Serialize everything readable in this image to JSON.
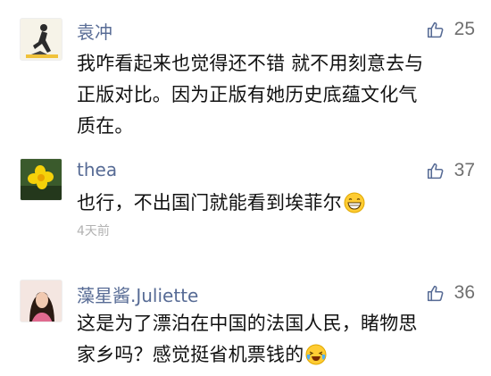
{
  "comments": [
    {
      "name": "袁冲",
      "likes": "25",
      "lines": [
        "我咋看起来也觉得还不错 就不用刻意去与",
        "正版对比。因为正版有她历史底蕴文化气",
        "质在。"
      ],
      "time": "",
      "avatar_icon": "yoga-person-avatar"
    },
    {
      "name": "thea",
      "likes": "37",
      "lines": [
        "也行，不出国门就能看到埃菲尔"
      ],
      "emoji": "grinning-face-icon",
      "time": "4天前",
      "avatar_icon": "yellow-flower-avatar"
    },
    {
      "name": "藻星酱.Juliette",
      "likes": "36",
      "lines": [
        "这是为了漂泊在中国的法国人民，睹物思",
        "家乡吗？感觉挺省机票钱的"
      ],
      "emoji": "crying-laughing-face-icon",
      "time": "",
      "avatar_icon": "woman-portrait-avatar"
    }
  ],
  "colors": {
    "name": "#576b95",
    "text": "#111111",
    "meta": "#b2b2b2",
    "count": "#6f6f6f"
  }
}
